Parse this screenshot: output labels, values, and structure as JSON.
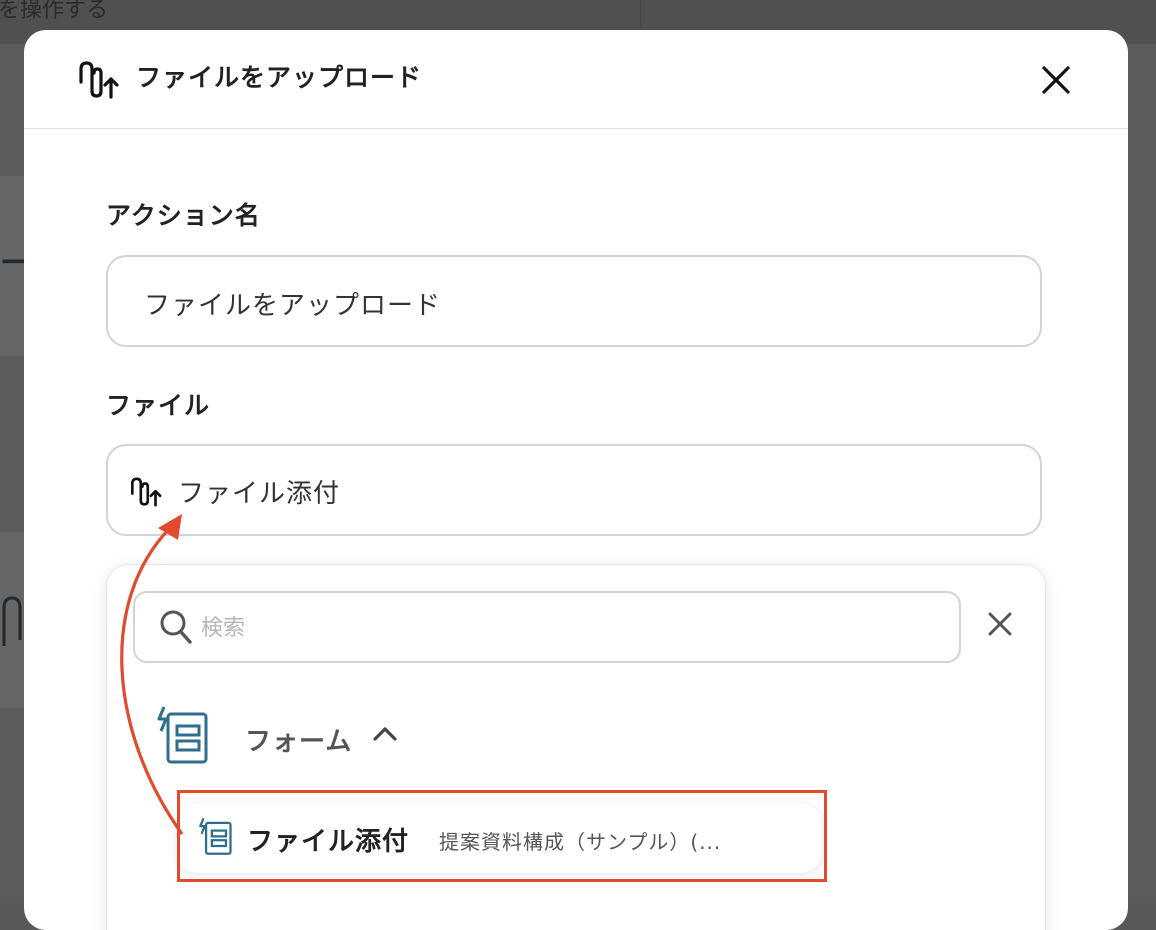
{
  "background": {
    "partial_text": "を操作する"
  },
  "modal": {
    "title": "ファイルをアップロード",
    "close_icon": "close-icon"
  },
  "form": {
    "action_name": {
      "label": "アクション名",
      "value": "ファイルをアップロード"
    },
    "file": {
      "label": "ファイル",
      "value": "ファイル添付",
      "icon": "paperclip-upload-icon"
    }
  },
  "dropdown": {
    "search": {
      "placeholder": "検索",
      "value": ""
    },
    "group": {
      "label": "フォーム",
      "icon": "form-trigger-icon",
      "expanded": true
    },
    "options": [
      {
        "title": "ファイル添付",
        "subtitle": "提案資料構成（サンプル）(..."
      }
    ]
  },
  "colors": {
    "accent_annotation": "#e14a2f",
    "form_icon": "#2e6e8e",
    "input_border": "#d3d3d3"
  }
}
